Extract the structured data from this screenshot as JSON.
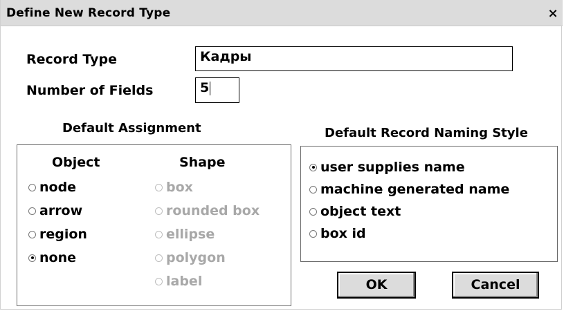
{
  "window": {
    "title": "Define New Record Type",
    "close_symbol": "×"
  },
  "record_type": {
    "label": "Record Type",
    "value": "Кадры"
  },
  "number_of_fields": {
    "label": "Number of Fields",
    "value": "5"
  },
  "default_assignment": {
    "heading": "Default Assignment",
    "object": {
      "header": "Object",
      "options": [
        {
          "label": "node",
          "selected": false
        },
        {
          "label": "arrow",
          "selected": false
        },
        {
          "label": "region",
          "selected": false
        },
        {
          "label": "none",
          "selected": true
        }
      ]
    },
    "shape": {
      "header": "Shape",
      "disabled": true,
      "options": [
        {
          "label": "box",
          "selected": false
        },
        {
          "label": "rounded box",
          "selected": false
        },
        {
          "label": "ellipse",
          "selected": false
        },
        {
          "label": "polygon",
          "selected": false
        },
        {
          "label": "label",
          "selected": false
        }
      ]
    }
  },
  "naming_style": {
    "heading": "Default Record Naming Style",
    "options": [
      {
        "label": "user supplies name",
        "selected": true
      },
      {
        "label": "machine generated name",
        "selected": false
      },
      {
        "label": "object text",
        "selected": false
      },
      {
        "label": "box id",
        "selected": false
      }
    ]
  },
  "buttons": {
    "ok": "OK",
    "cancel": "Cancel"
  }
}
